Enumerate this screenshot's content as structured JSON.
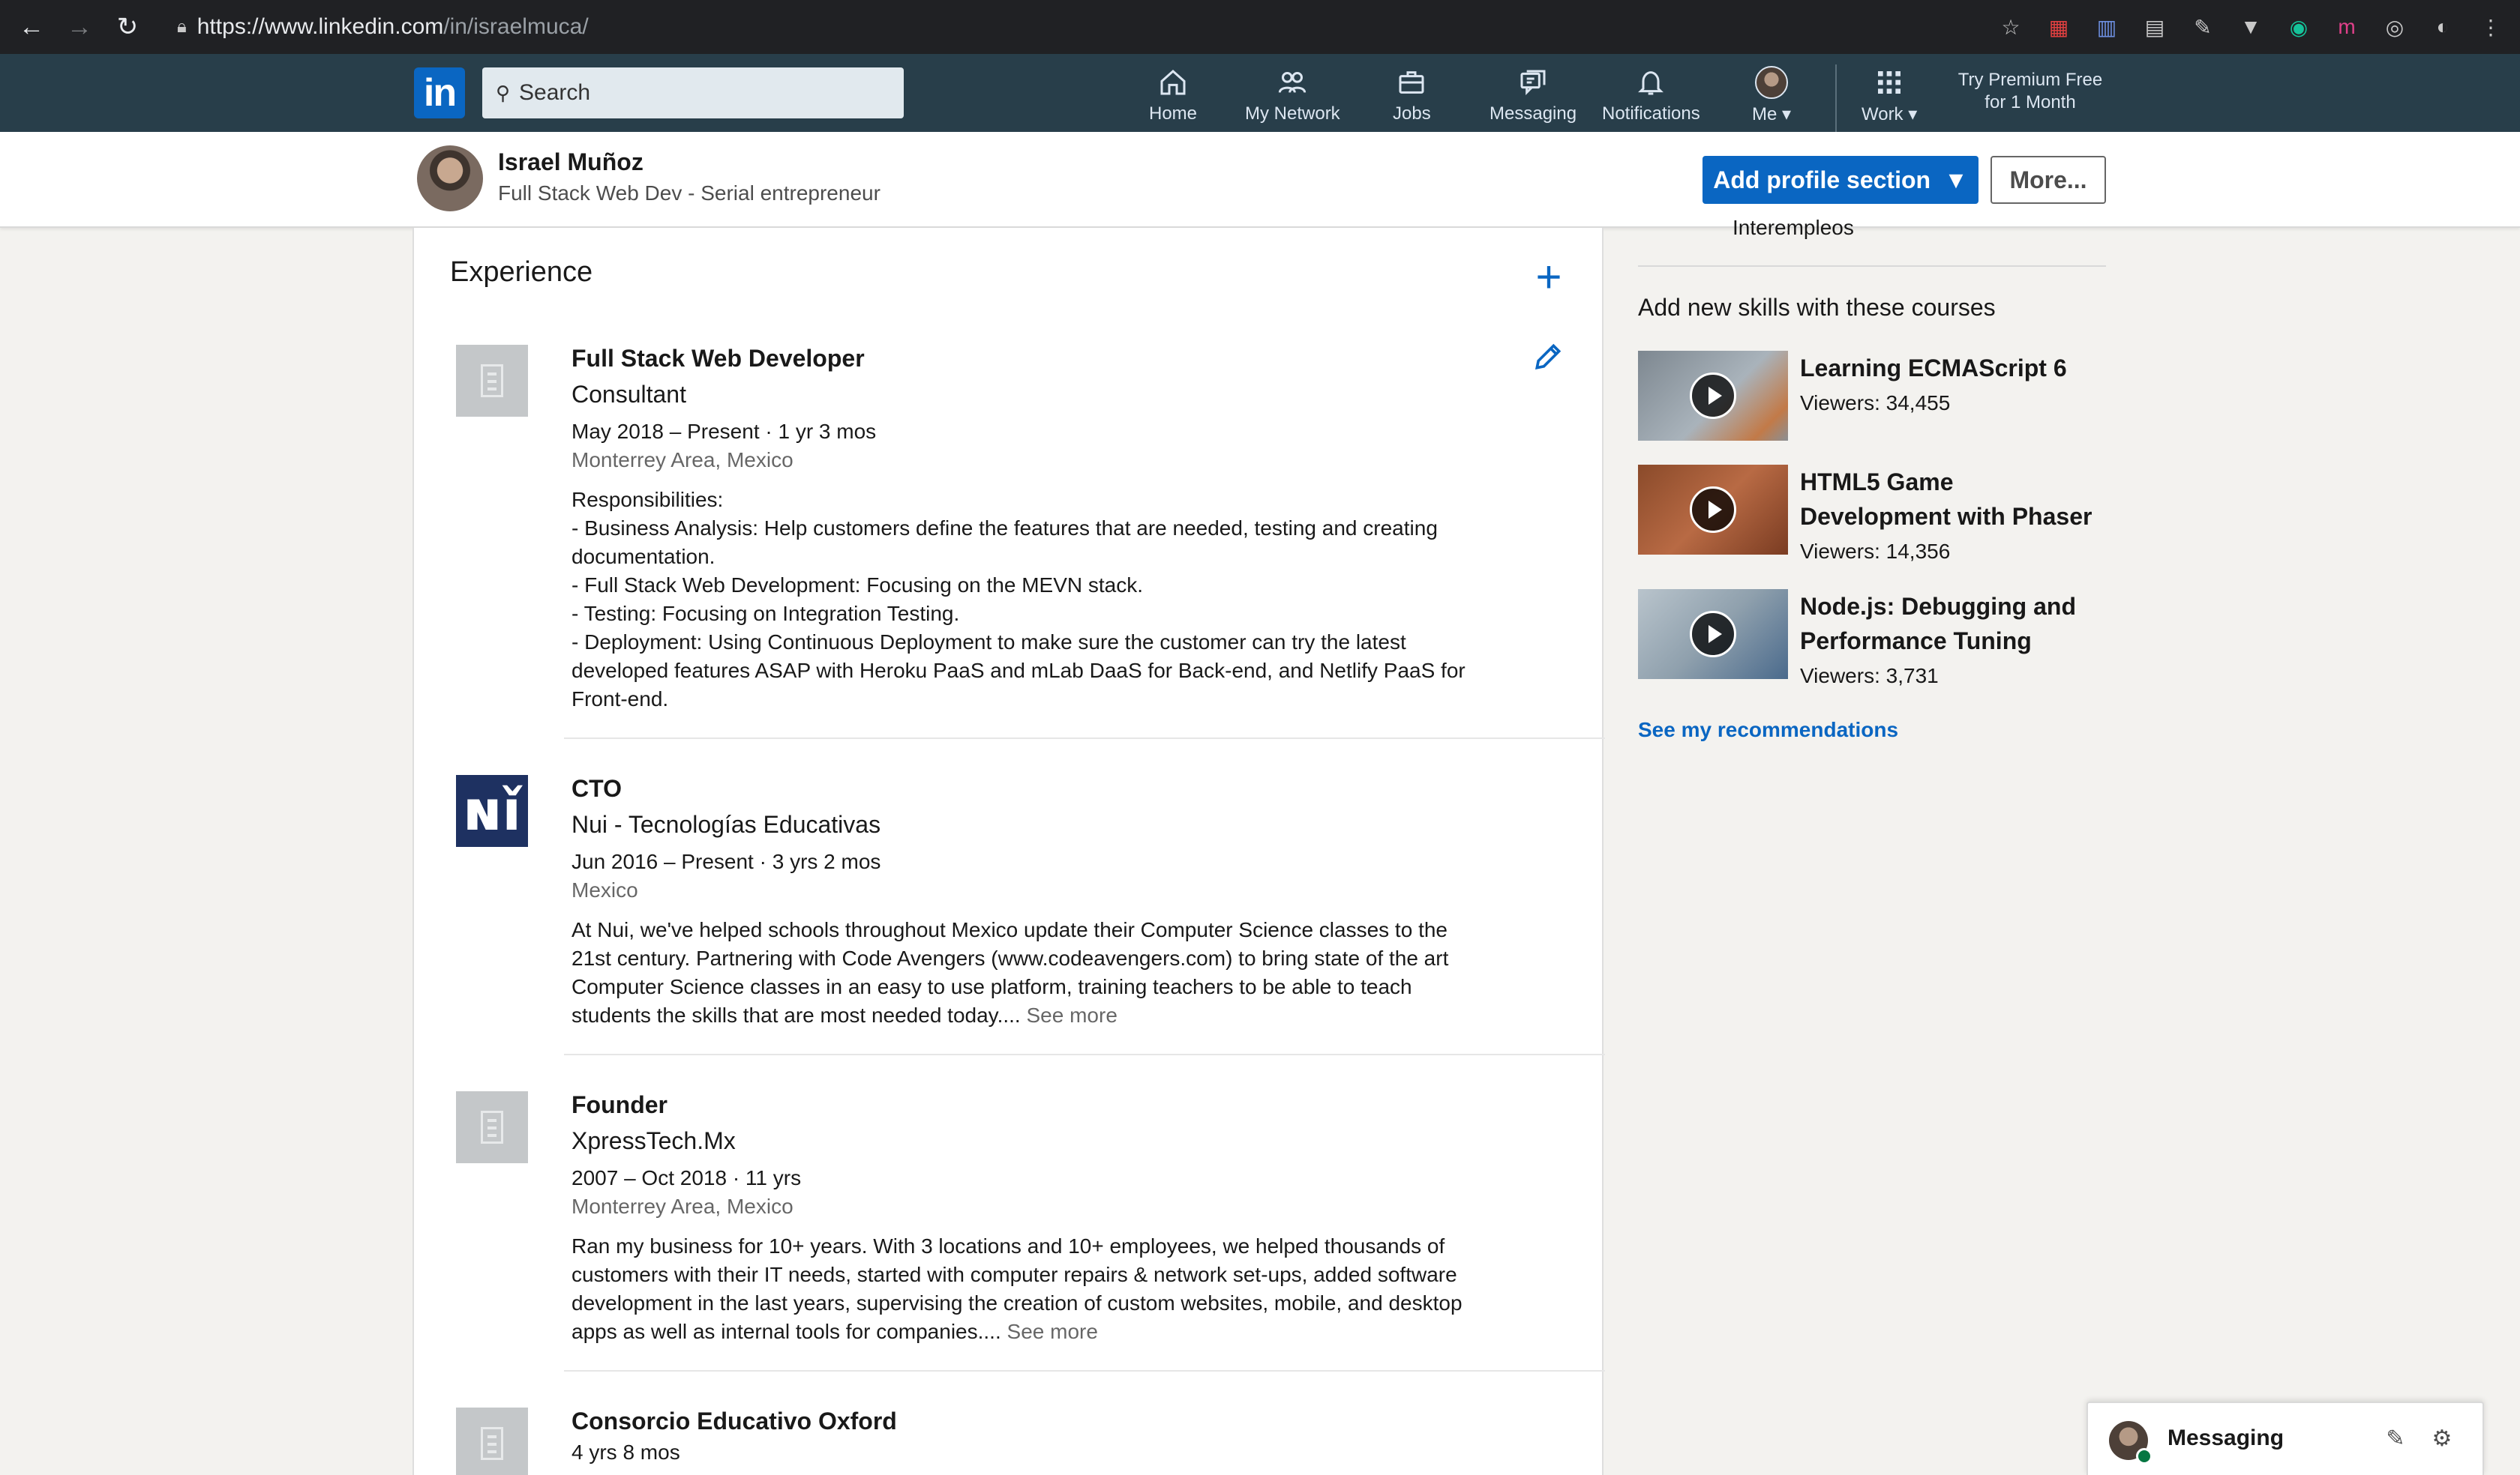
{
  "browser": {
    "url_base": "https://www.linkedin.com",
    "url_path": "/in/israelmuca/"
  },
  "nav": {
    "search_placeholder": "Search",
    "items": [
      "Home",
      "My Network",
      "Jobs",
      "Messaging",
      "Notifications",
      "Me",
      "Work"
    ],
    "premium_line1": "Try Premium Free",
    "premium_line2": "for 1 Month"
  },
  "profile": {
    "name": "Israel Muñoz",
    "headline": "Full Stack Web Dev - Serial entrepreneur",
    "add_section_label": "Add profile section",
    "more_label": "More..."
  },
  "experience": {
    "title": "Experience",
    "jobs": [
      {
        "title": "Full Stack Web Developer",
        "company": "Consultant",
        "dates": "May 2018 – Present  ·  1 yr 3 mos",
        "location": "Monterrey Area, Mexico",
        "description": "Responsibilities:\n- Business Analysis: Help customers define the features that are needed, testing and creating documentation.\n- Full Stack Web Development: Focusing on the MEVN stack.\n- Testing: Focusing on Integration Testing.\n- Deployment: Using Continuous Deployment to make sure the customer can try the latest developed features ASAP with Heroku PaaS and mLab DaaS for Back-end, and Netlify PaaS for Front-end."
      },
      {
        "title": "CTO",
        "company": "Nui - Tecnologías Educativas",
        "dates": "Jun 2016 – Present  ·  3 yrs 2 mos",
        "location": "Mexico",
        "description": "At Nui, we've helped schools throughout Mexico update their Computer Science classes to the 21st century. Partnering with Code Avengers (www.codeavengers.com) to bring state of the art Computer Science classes in an easy to use platform, training teachers to be able to teach students the skills that are most needed today....",
        "see_more": "See more",
        "logo_text": "ɴǐ"
      },
      {
        "title": "Founder",
        "company": "XpressTech.Mx",
        "dates": "2007 – Oct 2018  ·  11 yrs",
        "location": "Monterrey Area, Mexico",
        "description": "Ran my business for 10+ years. With 3 locations and 10+ employees, we helped thousands of customers with their IT needs, started with computer repairs & network set-ups, added software development in the last years, supervising the creation of custom websites, mobile, and desktop apps as well as internal tools for companies....",
        "see_more": "See more"
      },
      {
        "title": "Consorcio Educativo Oxford",
        "duration": "4 yrs 8 mos"
      }
    ]
  },
  "rail": {
    "cut_text": "Interempleos",
    "heading": "Add new skills with these courses",
    "courses": [
      {
        "title": "Learning ECMAScript 6",
        "viewers": "Viewers: 34,455"
      },
      {
        "title": "HTML5 Game Development with Phaser",
        "viewers": "Viewers: 14,356"
      },
      {
        "title": "Node.js: Debugging and Performance Tuning",
        "viewers": "Viewers: 3,731"
      }
    ],
    "see_recommendations": "See my recommendations"
  },
  "messaging": {
    "label": "Messaging"
  },
  "colors": {
    "linkedin_blue": "#0a66c2",
    "nav_bg": "#283e4a",
    "chrome_bg": "#202124"
  }
}
